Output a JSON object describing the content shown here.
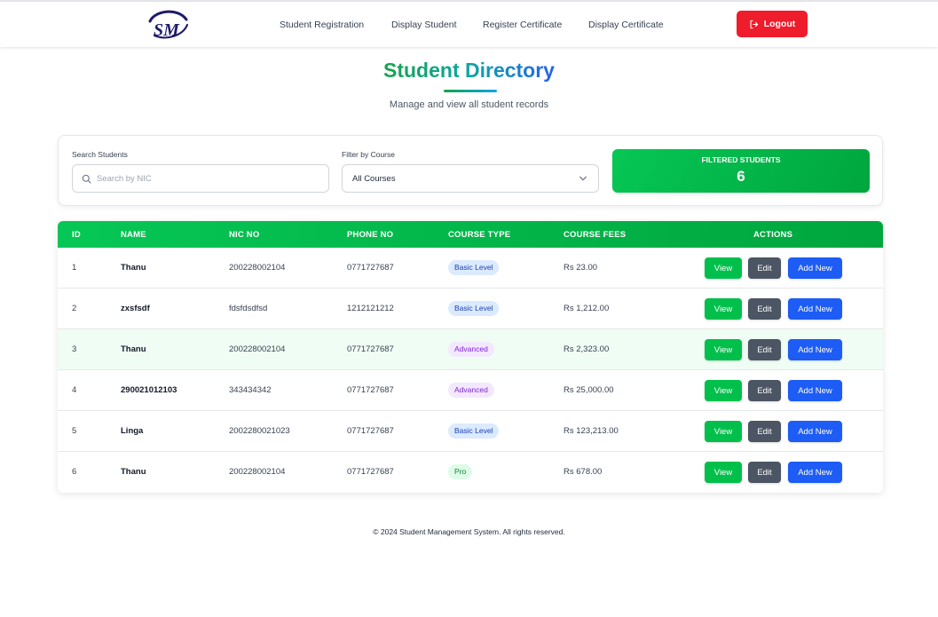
{
  "nav": {
    "logo_text": "SM",
    "links": [
      "Student Registration",
      "Display Student",
      "Register Certificate",
      "Display Certificate"
    ],
    "logout_label": "Logout",
    "logout_color": "#ef1c2b"
  },
  "header": {
    "title": "Student Directory",
    "subtitle": "Manage and view all student records"
  },
  "filters": {
    "search_label": "Search Students",
    "search_placeholder": "Search by NIC",
    "search_value": "",
    "course_label": "Filter by Course",
    "course_selected": "All Courses",
    "count_label": "FILTERED STUDENTS",
    "count_value": "6"
  },
  "table": {
    "columns": [
      "ID",
      "NAME",
      "NIC NO",
      "PHONE NO",
      "COURSE TYPE",
      "COURSE FEES",
      "ACTIONS"
    ],
    "action_labels": {
      "view": "View",
      "edit": "Edit",
      "add": "Add New"
    },
    "rows": [
      {
        "id": "1",
        "name": "Thanu",
        "nic": "200228002104",
        "phone": "0771727687",
        "course": "Basic Level",
        "course_kind": "basic",
        "fees": "Rs 23.00"
      },
      {
        "id": "2",
        "name": "zxsfsdf",
        "nic": "fdsfdsdfsd",
        "phone": "1212121212",
        "course": "Basic Level",
        "course_kind": "basic",
        "fees": "Rs 1,212.00"
      },
      {
        "id": "3",
        "name": "Thanu",
        "nic": "200228002104",
        "phone": "0771727687",
        "course": "Advanced",
        "course_kind": "advanced",
        "fees": "Rs 2,323.00"
      },
      {
        "id": "4",
        "name": "290021012103",
        "nic": "343434342",
        "phone": "0771727687",
        "course": "Advanced",
        "course_kind": "advanced",
        "fees": "Rs 25,000.00"
      },
      {
        "id": "5",
        "name": "Linga",
        "nic": "200228002​1023",
        "phone": "0771727687",
        "course": "Basic Level",
        "course_kind": "basic",
        "fees": "Rs 123,213.00"
      },
      {
        "id": "6",
        "name": "Thanu",
        "nic": "200228002104",
        "phone": "0771727687",
        "course": "Pro",
        "course_kind": "pro",
        "fees": "Rs 678.00"
      }
    ],
    "highlighted_row": 3
  },
  "footer": {
    "text": "© 2024 Student Management System. All rights reserved."
  }
}
